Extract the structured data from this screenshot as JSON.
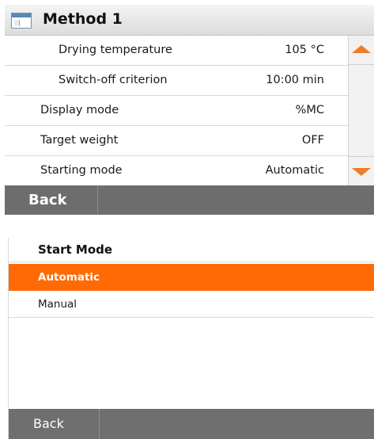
{
  "method_panel": {
    "title": "Method 1",
    "rows": [
      {
        "label": "Drying temperature",
        "value": "105 °C"
      },
      {
        "label": "Switch-off criterion",
        "value": "10:00 min"
      },
      {
        "label": "Display mode",
        "value": "%MC"
      },
      {
        "label": "Target weight",
        "value": "OFF"
      },
      {
        "label": "Starting mode",
        "value": "Automatic"
      }
    ],
    "back_label": "Back"
  },
  "start_mode_panel": {
    "title": "Start Mode",
    "options": [
      "Automatic",
      "Manual"
    ],
    "selected": "Automatic",
    "back_label": "Back"
  },
  "colors": {
    "accent": "#ff6a06",
    "footer": "#6d6d6d"
  },
  "icons": [
    "window-icon",
    "scroll-up-arrow-icon",
    "scroll-down-arrow-icon"
  ]
}
